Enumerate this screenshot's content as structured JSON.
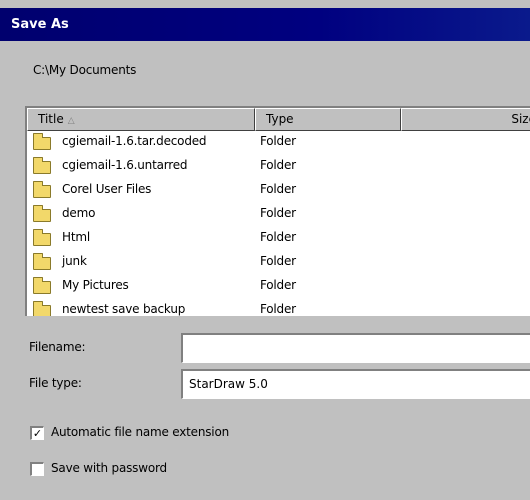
{
  "window": {
    "title": "Save As"
  },
  "current_path": "C:\\My Documents",
  "file_list": {
    "columns": [
      "Title",
      "Type",
      "Size"
    ],
    "rows": [
      {
        "name": "cgiemail-1.6.tar.decoded",
        "type": "Folder"
      },
      {
        "name": "cgiemail-1.6.untarred",
        "type": "Folder"
      },
      {
        "name": "Corel User Files",
        "type": "Folder"
      },
      {
        "name": "demo",
        "type": "Folder"
      },
      {
        "name": "Html",
        "type": "Folder"
      },
      {
        "name": "junk",
        "type": "Folder"
      },
      {
        "name": "My Pictures",
        "type": "Folder"
      },
      {
        "name": "newtest save backup",
        "type": "Folder"
      }
    ]
  },
  "filename": {
    "label": "Filename:",
    "value": ""
  },
  "filetype": {
    "label": "File type:",
    "value": "StarDraw 5.0"
  },
  "options": {
    "auto_extension": {
      "label": "Automatic file name extension",
      "checked": true,
      "mark": "✓"
    },
    "save_with_password": {
      "label": "Save with password",
      "checked": false,
      "mark": ""
    }
  },
  "colors": {
    "titlebar": "#000080",
    "face": "#c0c0c0"
  }
}
